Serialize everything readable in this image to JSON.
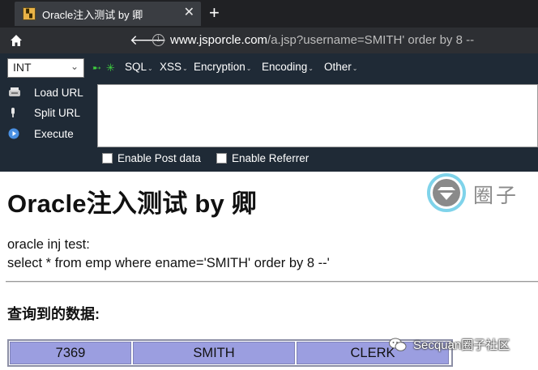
{
  "browser": {
    "tab_title": "Oracle注入测试 by 卿",
    "tab_close": "✕",
    "new_tab": "+",
    "url_host": "www.jsporcle.com",
    "url_path": "/a.jsp?username=SMITH' order by 8 --"
  },
  "hackbar": {
    "select_value": "INT",
    "menus": [
      "SQL",
      "XSS",
      "Encryption",
      "Encoding",
      "Other"
    ],
    "actions": [
      "Load URL",
      "Split URL",
      "Execute"
    ],
    "textarea_value": "",
    "checkboxes": [
      {
        "label": "Enable Post data",
        "checked": false
      },
      {
        "label": "Enable Referrer",
        "checked": false
      }
    ]
  },
  "page": {
    "title": "Oracle注入测试 by 卿",
    "line1": "oracle inj test:",
    "line2": "select * from emp where ename='SMITH' order by 8 --'",
    "section_heading": "查询到的数据:",
    "table_rows": [
      [
        "7369",
        "SMITH",
        "CLERK"
      ]
    ]
  },
  "watermark": {
    "logo_text": "圈子",
    "footer_text": "Secquan圈子社区"
  },
  "colors": {
    "chrome_dark": "#202124",
    "hackbar_bg": "#1f2a36",
    "table_cell": "#9b9ee0"
  }
}
